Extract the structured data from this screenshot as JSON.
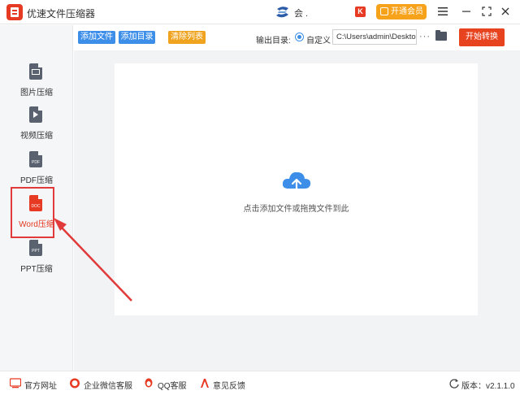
{
  "app": {
    "title": "优速文件压缩器",
    "user_name": "会 .",
    "vip_label": "开通会员"
  },
  "sidebar": {
    "items": [
      {
        "label": "图片压缩",
        "tag": ""
      },
      {
        "label": "视频压缩",
        "tag": ""
      },
      {
        "label": "PDF压缩",
        "tag": "PDF"
      },
      {
        "label": "Word压缩",
        "tag": "DOC"
      },
      {
        "label": "PPT压缩",
        "tag": "PPT"
      }
    ],
    "active_index": 3
  },
  "toolbar": {
    "add_file_label": "添加文件",
    "add_dir_label": "添加目录",
    "clear_label": "清除列表",
    "output_label": "输出目录:",
    "radio_label": "自定义",
    "output_path": "C:\\Users\\admin\\Deskto",
    "more_label": "···",
    "start_label": "开始转换"
  },
  "main": {
    "drop_hint": "点击添加文件或拖拽文件到此"
  },
  "footer": {
    "site_label": "官方网址",
    "wechat_label": "企业微信客服",
    "qq_label": "QQ客服",
    "feedback_label": "意见反馈",
    "version_label": "版本：",
    "version_value": "v2.1.1.0"
  },
  "colors": {
    "accent_red": "#e8431f",
    "accent_blue": "#3d8ee8",
    "accent_orange": "#f0a31e",
    "annotation_red": "#e03a3a"
  }
}
